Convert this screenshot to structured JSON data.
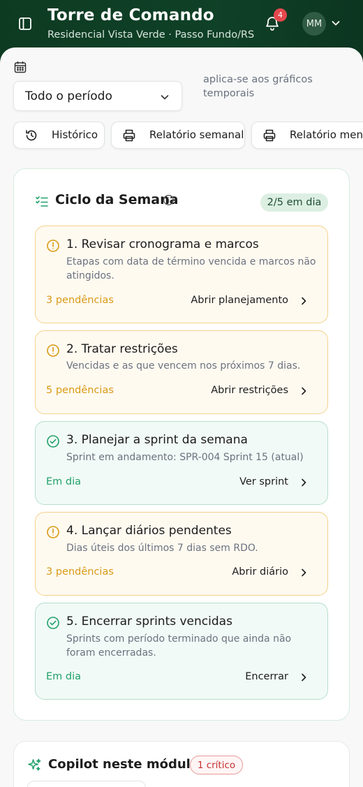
{
  "header": {
    "title": "Torre de Comando",
    "subtitle": "Residencial Vista Verde · Passo Fundo/RS",
    "notifications_count": "4",
    "avatar_initials": "MM",
    "icons": [
      "sidebar-toggle-icon",
      "bell-icon",
      "chevron-down-icon"
    ]
  },
  "filters": {
    "period_value": "Todo o período",
    "period_note": "aplica-se aos gráficos temporais"
  },
  "actions": [
    {
      "label": "Histórico",
      "icon": "history-icon"
    },
    {
      "label": "Relatório semanal",
      "icon": "printer-icon"
    },
    {
      "label": "Relatório mensal",
      "icon": "printer-icon"
    }
  ],
  "cycle": {
    "title": "Ciclo da Semana",
    "status": "2/5 em dia",
    "tasks": [
      {
        "title": "1. Revisar cronograma e marcos",
        "description": "Etapas com data de término vencida e marcos não atingidos.",
        "status": "3 pendências",
        "action": "Abrir planejamento",
        "state": "warning"
      },
      {
        "title": "2. Tratar restrições",
        "description": "Vencidas e as que vencem nos próximos 7 dias.",
        "status": "5 pendências",
        "action": "Abrir restrições",
        "state": "warning"
      },
      {
        "title": "3. Planejar a sprint da semana",
        "description": "Sprint em andamento: SPR-004 Sprint 15 (atual)",
        "status": "Em dia",
        "action": "Ver sprint",
        "state": "ok"
      },
      {
        "title": "4. Lançar diários pendentes",
        "description": "Dias úteis dos últimos 7 dias sem RDO.",
        "status": "3 pendências",
        "action": "Abrir diário",
        "state": "warning"
      },
      {
        "title": "5. Encerrar sprints vencidas",
        "description": "Sprints com período terminado que ainda não foram encerradas.",
        "status": "Em dia",
        "action": "Encerrar",
        "state": "ok"
      }
    ]
  },
  "copilot": {
    "title": "Copilot neste módulo",
    "critical_badge": "1 crítico"
  },
  "colors": {
    "header_bg": "#0d3b22",
    "warning": "#d99a16",
    "ok": "#22a06b",
    "critical": "#c53030"
  }
}
